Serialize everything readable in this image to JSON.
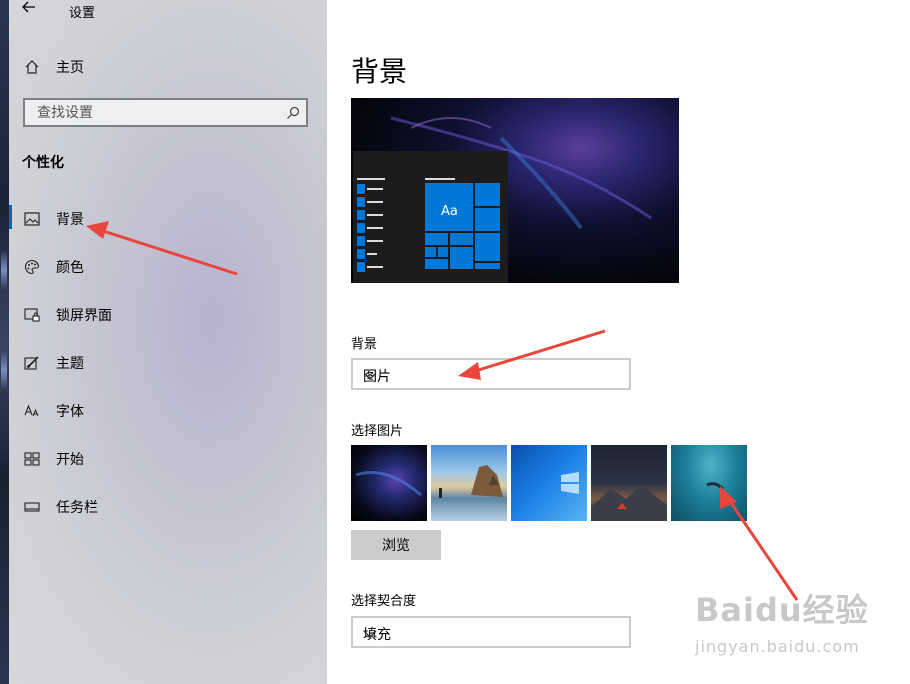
{
  "window": {
    "title": "设置",
    "back_icon": "arrow-left-icon"
  },
  "sidebar": {
    "home": "主页",
    "search_placeholder": "查找设置",
    "section": "个性化",
    "items": [
      {
        "label": "背景",
        "icon": "picture-icon",
        "active": true
      },
      {
        "label": "颜色",
        "icon": "palette-icon",
        "active": false
      },
      {
        "label": "锁屏界面",
        "icon": "lock-screen-icon",
        "active": false
      },
      {
        "label": "主题",
        "icon": "theme-icon",
        "active": false
      },
      {
        "label": "字体",
        "icon": "font-icon",
        "active": false
      },
      {
        "label": "开始",
        "icon": "start-icon",
        "active": false
      },
      {
        "label": "任务栏",
        "icon": "taskbar-icon",
        "active": false
      }
    ]
  },
  "main": {
    "title": "背景",
    "preview_tile_text": "Aa",
    "background_label": "背景",
    "background_value": "图片",
    "choose_picture_label": "选择图片",
    "browse_label": "浏览",
    "fit_label": "选择契合度",
    "fit_value": "填充"
  },
  "watermark": {
    "brand": "Baidu经验",
    "url": "jingyan.baidu.com"
  },
  "colors": {
    "accent": "#0067c0",
    "arrow": "#e8453c",
    "tile": "#0078d7"
  }
}
